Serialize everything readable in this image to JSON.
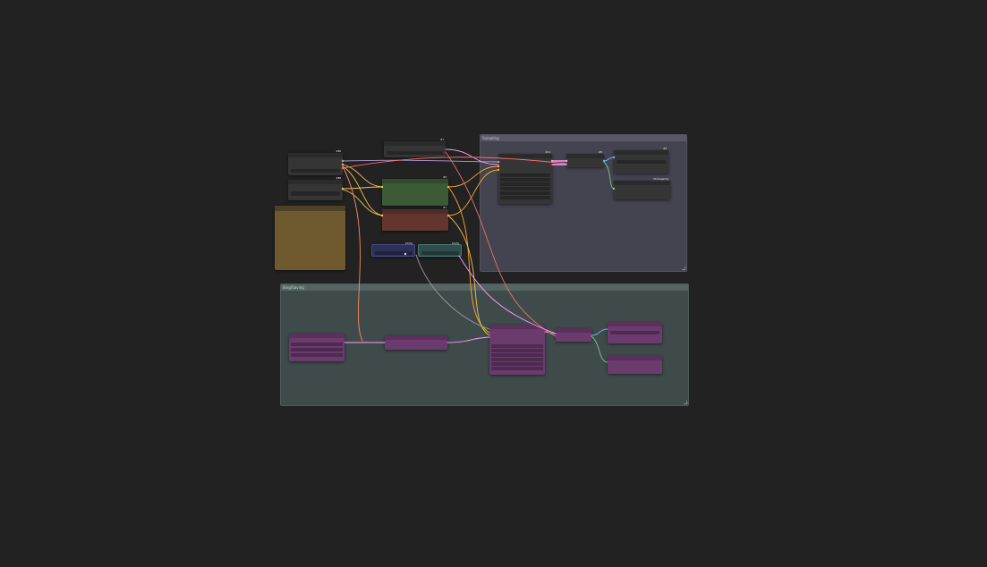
{
  "colors": {
    "canvas_bg": "#222222",
    "group_sampling": "#444350",
    "group_sampling_header": "#5a5868",
    "group_second": "#3f4b4b",
    "group_second_header": "#566563",
    "node_dark": "#353535",
    "node_dark_title": "#2b2b2b",
    "node_green": "#3c5a36",
    "node_red": "#62362f",
    "node_purple": "#6b3b6e",
    "node_blue": "#2f2f58",
    "node_teal": "#2f4d4b",
    "note_yellow": "#6e5a2e",
    "wire_model": "#b39ddb",
    "wire_clip": "#f6c34a",
    "wire_vae": "#ff6e6e",
    "wire_conditioning": "#ffa931",
    "wire_latent": "#ff9cf9",
    "wire_image": "#64b5f6",
    "wire_mask": "#81c784",
    "wire_misc": "#9e9e9e"
  },
  "groups": {
    "sampling": {
      "title": "Sampling"
    },
    "second": {
      "title": "Bing/Saving"
    }
  },
  "nodes": {
    "loader_a": {
      "badge": "#88"
    },
    "loader_b": {
      "badge": "#88"
    },
    "model_top": {
      "badge": "#7"
    },
    "prompt_positive": {
      "badge": "#6"
    },
    "prompt_negative": {
      "badge": "#7"
    },
    "mini_left": {
      "badge": "int/cfg"
    },
    "mini_right": {
      "badge": "int/cfg"
    },
    "ksampler": {
      "badge": "#14"
    },
    "vae_decode": {
      "badge": "#8"
    },
    "save_image": {
      "badge": "#9"
    },
    "preview_image": {
      "badge": "ctl/image/cfg"
    },
    "p_loader": {
      "badge": ""
    },
    "p_mid": {
      "badge": ""
    },
    "p_sampler": {
      "badge": ""
    },
    "p_small": {
      "badge": ""
    },
    "p_out_top": {
      "badge": ""
    },
    "p_out_bottom": {
      "badge": ""
    }
  }
}
